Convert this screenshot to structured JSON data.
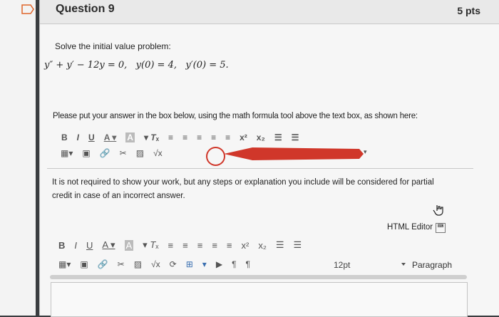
{
  "question": {
    "title": "Question 9",
    "points": "5 pts"
  },
  "prompt": {
    "intro": "Solve the initial value problem:",
    "equation": "y″ + y′ − 12y = 0,   y(0) = 4,   y′(0) = 5."
  },
  "instruction": "Please put your answer in the box below, using the math formula tool above the text box, as shown here:",
  "note_line1": "It is not required to show your work, but any steps or explanation you include will be considered for partial",
  "note_line2": "credit in case of an incorrect answer.",
  "editor": {
    "html_editor_label": "HTML Editor",
    "font_size": "12pt",
    "block_format": "Paragraph"
  },
  "colors": {
    "highlight_red": "#d0372a",
    "card_bg": "#f6f6f6",
    "header_bg": "#e9e9e9"
  }
}
